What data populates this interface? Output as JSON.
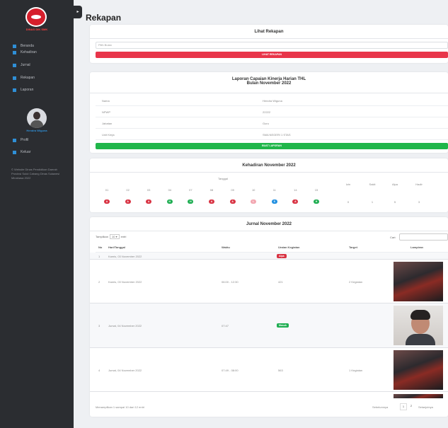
{
  "sidebar": {
    "logo_text": "DINAS DIK SMK",
    "items": [
      {
        "label": "Beranda",
        "icon": "home-icon"
      },
      {
        "label": "Kehadiran",
        "icon": "calendar-icon"
      },
      {
        "label": "Jurnal",
        "icon": "list-icon"
      },
      {
        "label": "Rekapan",
        "icon": "chart-icon"
      },
      {
        "label": "Laporan",
        "icon": "report-icon"
      }
    ],
    "user_name": "Hendra Wiguna",
    "user_items": [
      {
        "label": "Profil",
        "icon": "profile-icon"
      },
      {
        "label": "Keluar",
        "icon": "logout-icon"
      }
    ],
    "footer": "© Website Dinas Pendidikan Daerah Provinsi Sulut Cabang Dinas Sulawesi Minahasa 2022"
  },
  "page": {
    "title": "Rekapan",
    "toggle": "▸"
  },
  "lihat": {
    "heading": "Lihat Rekapan",
    "placeholder": "Pilih Bulan",
    "button": "LIHAT REKAPAN"
  },
  "laporan": {
    "heading_1": "Laporan Capaian Kinerja Harian THL",
    "heading_2": "Bulan November 2022",
    "rows": [
      {
        "label": "Nama",
        "value": "Hendra Wiguna"
      },
      {
        "label": "NPWP",
        "value": "22222"
      },
      {
        "label": "Jabatan",
        "value": "Guru"
      },
      {
        "label": "Unit Kerja",
        "value": "SMA NEGERI 1 STAS"
      }
    ],
    "button": "BUAT LAPORAN"
  },
  "kehadiran": {
    "heading": "Kehadiran November 2022",
    "tanggal_label": "Tanggal",
    "dates": [
      "01",
      "02",
      "03",
      "04",
      "07",
      "08",
      "09",
      "10",
      "11",
      "14",
      "15"
    ],
    "status": [
      "A",
      "A",
      "A",
      "H",
      "H",
      "A",
      "A",
      "L",
      "S",
      "A",
      "H"
    ],
    "status_colors": {
      "A": "#d83242",
      "H": "#1fae52",
      "L": "#f2a6b0",
      "S": "#1f8ee0"
    },
    "summary_headers": [
      "Izin",
      "Sakit",
      "Alpa",
      "Hadir"
    ],
    "summary_values": [
      "0",
      "1",
      "5",
      "3"
    ]
  },
  "jurnal": {
    "heading": "Jurnal November 2022",
    "show_label": "Tampilkan",
    "show_value": "10",
    "show_suffix": "entri",
    "search_label": "Cari:",
    "headers": [
      "No",
      "Hari/Tanggal",
      "Waktu",
      "Uraian Kegiatan",
      "Target",
      "Lampiran"
    ],
    "rows": [
      {
        "no": "1",
        "date": "Kamis, 03 November 2022",
        "time": "",
        "desc": "Alpa",
        "desc_color": "#d83242",
        "target": "",
        "photo": "none"
      },
      {
        "no": "2",
        "date": "Kamis, 03 November 2022",
        "time": "06:00 - 12:30",
        "desc": "421",
        "desc_color": "",
        "target": "2 Kegiatan",
        "photo": "dark"
      },
      {
        "no": "3",
        "date": "Jumat, 04 November 2022",
        "time": "07:47",
        "desc": "Masuk",
        "desc_color": "#1fae52",
        "target": "",
        "photo": "face"
      },
      {
        "no": "4",
        "date": "Jumat, 04 November 2022",
        "time": "07:49 - 08:00",
        "desc": "563",
        "desc_color": "",
        "target": "1 Kegiatan",
        "photo": "dark"
      }
    ],
    "info": "Menampilkan 1 sampai 10 dari 12 entri",
    "prev": "Sebelumnya",
    "pages": [
      "1",
      "2"
    ],
    "next": "Selanjutnya"
  }
}
